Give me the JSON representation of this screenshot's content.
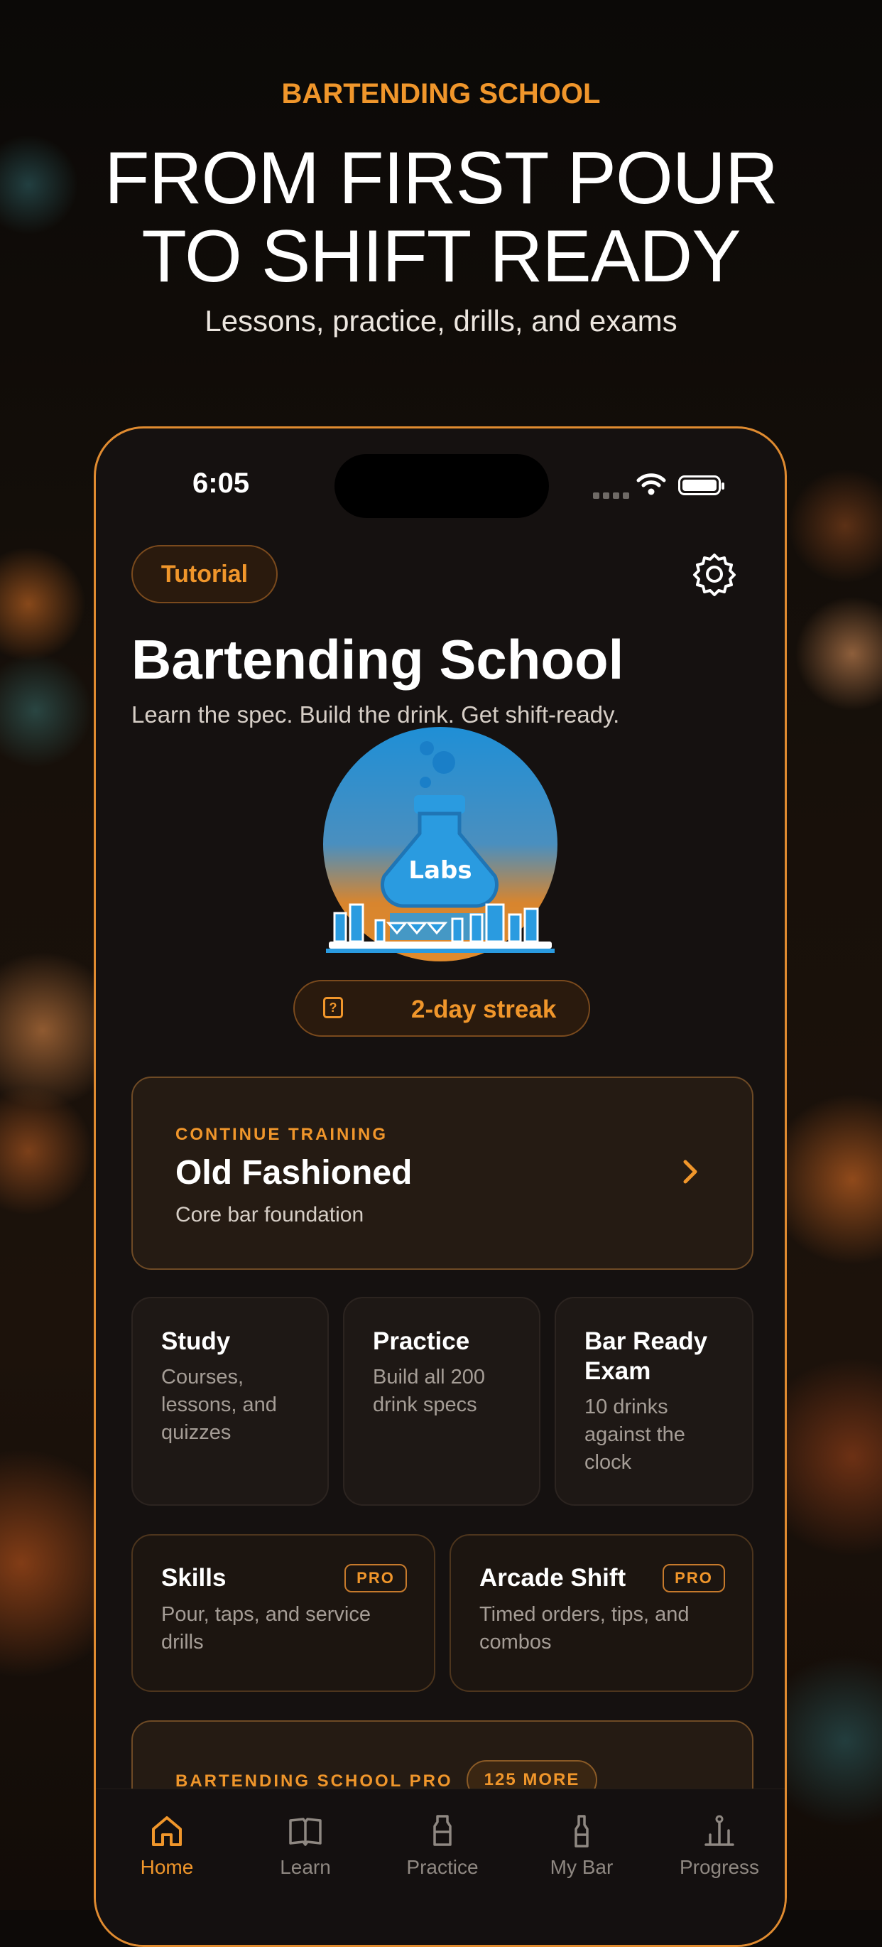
{
  "hero": {
    "eyebrow": "BARTENDING SCHOOL",
    "headline_line1": "FROM FIRST POUR",
    "headline_line2": "TO SHIFT READY",
    "subtitle": "Lessons, practice, drills, and exams"
  },
  "status_bar": {
    "time": "6:05"
  },
  "header": {
    "tutorial_button": "Tutorial",
    "title": "Bartending School",
    "tagline": "Learn the spec. Build the drink. Get shift-ready."
  },
  "logo": {
    "text": "Labs"
  },
  "streak": {
    "label": "2-day streak"
  },
  "continue_training": {
    "eyebrow": "CONTINUE TRAINING",
    "drink": "Old Fashioned",
    "subtitle": "Core bar foundation"
  },
  "tiles": [
    {
      "title": "Study",
      "description": "Courses, lessons, and quizzes"
    },
    {
      "title": "Practice",
      "description": "Build all 200 drink specs"
    },
    {
      "title": "Bar Ready Exam",
      "description": "10 drinks against the clock"
    }
  ],
  "pro_tiles": [
    {
      "title": "Skills",
      "badge": "PRO",
      "description": "Pour, taps, and service drills"
    },
    {
      "title": "Arcade Shift",
      "badge": "PRO",
      "description": "Timed orders, tips, and combos"
    }
  ],
  "pro_card": {
    "eyebrow": "BARTENDING SCHOOL PRO",
    "more_badge": "125 MORE"
  },
  "tab_bar": [
    {
      "label": "Home",
      "icon": "home-icon",
      "active": true
    },
    {
      "label": "Learn",
      "icon": "book-icon",
      "active": false
    },
    {
      "label": "Practice",
      "icon": "bottle-icon",
      "active": false
    },
    {
      "label": "My Bar",
      "icon": "wine-bottle-icon",
      "active": false
    },
    {
      "label": "Progress",
      "icon": "podium-icon",
      "active": false
    }
  ],
  "colors": {
    "accent": "#f0962b",
    "background": "#151110",
    "card": "#251b13",
    "text": "#ffffff"
  }
}
